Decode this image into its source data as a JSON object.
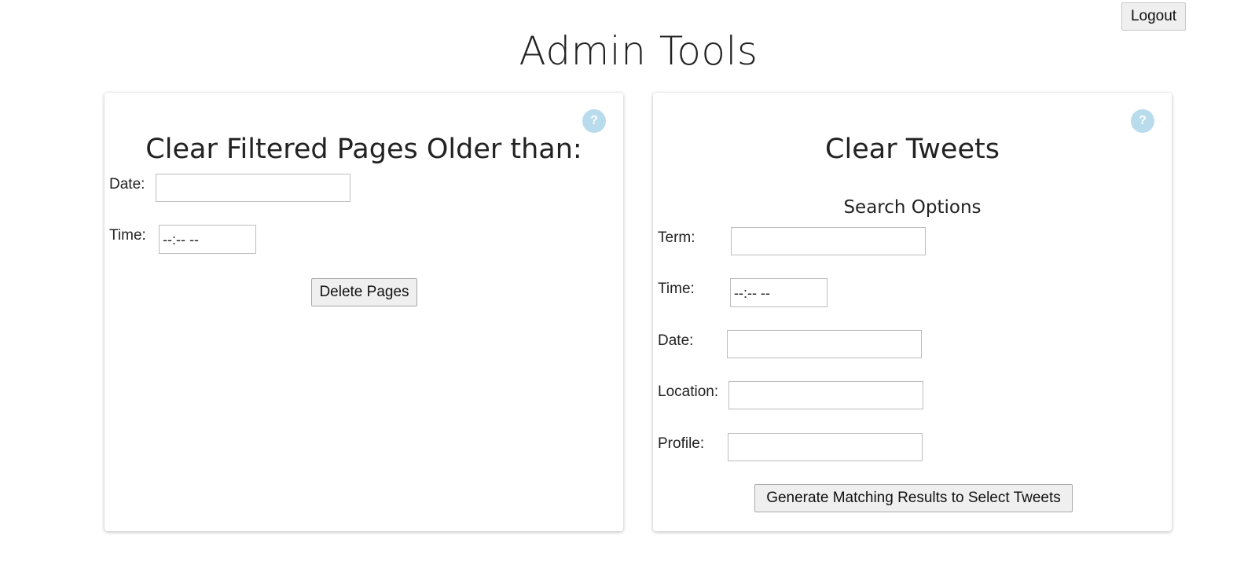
{
  "header": {
    "logout_label": "Logout",
    "title": "Admin Tools"
  },
  "left_panel": {
    "help_icon": "?",
    "title": "Clear Filtered Pages Older than:",
    "date_label": "Date:",
    "date_value": "",
    "time_label": "Time:",
    "time_value": "--:-- --",
    "delete_button": "Delete Pages"
  },
  "right_panel": {
    "help_icon": "?",
    "title": "Clear Tweets",
    "subtitle": "Search Options",
    "term_label": "Term:",
    "term_value": "",
    "time_label": "Time:",
    "time_value": "--:-- --",
    "date_label": "Date:",
    "date_value": "",
    "location_label": "Location:",
    "location_value": "",
    "profile_label": "Profile:",
    "profile_value": "",
    "generate_button": "Generate Matching Results to Select Tweets"
  },
  "colors": {
    "help_icon_bg": "#b9dcec",
    "button_bg": "#efefef",
    "text": "#222222"
  }
}
